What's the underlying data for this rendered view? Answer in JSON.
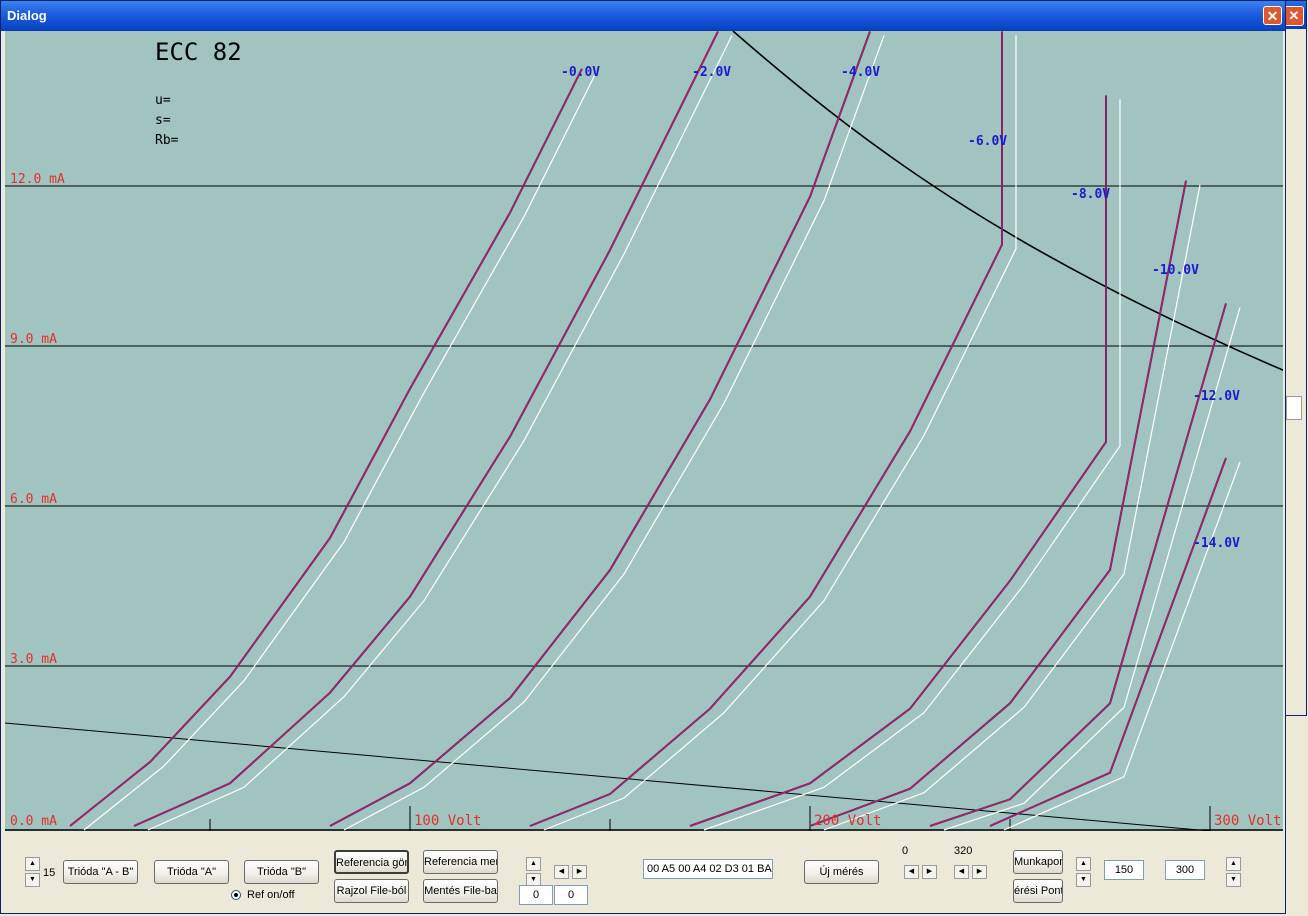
{
  "window": {
    "title": "Dialog",
    "close_glyph": "✕"
  },
  "plot": {
    "tube": "ECC 82",
    "params": {
      "u": "u=",
      "s": "s=",
      "rb": "Rb="
    },
    "y_labels": [
      "12.0 mA",
      "9.0 mA",
      "6.0 mA",
      "3.0 mA",
      "0.0 mA"
    ],
    "x_labels": [
      "100 Volt",
      "200 Volt",
      "300 Volt"
    ],
    "grid_labels": [
      "-0.0V",
      "-2.0V",
      "-4.0V",
      "-6.0V",
      "-8.0V",
      "-10.0V",
      "-12.0V",
      "-14.0V"
    ],
    "colors": {
      "background": "#a1c4c0",
      "axis_text": "#e03030",
      "grid_text": "#1a1ad0",
      "measured": "#2020d0",
      "reference": "#d02020",
      "alt": "#ffffff"
    }
  },
  "chart_data": {
    "type": "line",
    "xlabel": "Volt",
    "ylabel": "mA",
    "xlim": [
      0,
      320
    ],
    "ylim": [
      0,
      15
    ],
    "x_ticks": [
      "100 Volt",
      "200 Volt",
      "300 Volt"
    ],
    "y_ticks": [
      "0.0 mA",
      "3.0 mA",
      "6.0 mA",
      "9.0 mA",
      "12.0 mA"
    ],
    "series": [
      {
        "name": "-0.0V",
        "points": [
          [
            15,
            0
          ],
          [
            35,
            1.2
          ],
          [
            55,
            2.8
          ],
          [
            80,
            5.4
          ],
          [
            100,
            8.2
          ],
          [
            125,
            11.5
          ],
          [
            143,
            14.2
          ]
        ]
      },
      {
        "name": "-2.0V",
        "points": [
          [
            31,
            0
          ],
          [
            55,
            0.8
          ],
          [
            80,
            2.5
          ],
          [
            100,
            4.3
          ],
          [
            125,
            7.3
          ],
          [
            150,
            10.8
          ],
          [
            177,
            14.9
          ]
        ]
      },
      {
        "name": "-4.0V",
        "points": [
          [
            80,
            0
          ],
          [
            100,
            0.8
          ],
          [
            125,
            2.4
          ],
          [
            150,
            4.8
          ],
          [
            175,
            8.0
          ],
          [
            200,
            11.8
          ],
          [
            215,
            14.9
          ]
        ]
      },
      {
        "name": "-6.0V",
        "points": [
          [
            130,
            0
          ],
          [
            150,
            0.6
          ],
          [
            175,
            2.2
          ],
          [
            200,
            4.3
          ],
          [
            225,
            7.4
          ],
          [
            248,
            10.9
          ],
          [
            248,
            14.9
          ]
        ]
      },
      {
        "name": "-8.0V",
        "points": [
          [
            170,
            0
          ],
          [
            200,
            0.8
          ],
          [
            225,
            2.2
          ],
          [
            250,
            4.6
          ],
          [
            274,
            7.2
          ],
          [
            274,
            13.7
          ]
        ]
      },
      {
        "name": "-10.0V",
        "points": [
          [
            200,
            0
          ],
          [
            225,
            0.7
          ],
          [
            250,
            2.3
          ],
          [
            275,
            4.8
          ],
          [
            294,
            12.1
          ]
        ]
      },
      {
        "name": "-12.0V",
        "points": [
          [
            230,
            0
          ],
          [
            250,
            0.5
          ],
          [
            275,
            2.3
          ],
          [
            304,
            9.8
          ]
        ]
      },
      {
        "name": "-14.0V",
        "points": [
          [
            245,
            0
          ],
          [
            275,
            1.0
          ],
          [
            304,
            6.9
          ]
        ]
      }
    ]
  },
  "controls": {
    "spin_value": "15",
    "buttons": {
      "trioda_ab": "Trióda \"A - B\"",
      "trioda_a": "Trióda  \"A\"",
      "trioda_b": "Trióda  \"B\"",
      "ref_curve": "Referencia görb",
      "ref_save": "Referencia menté",
      "draw_file": "Rajzol File-ból",
      "save_file": "Mentés File-ba",
      "new_measure": "Új mérés",
      "workpoint": "Munkapon",
      "meas_point": "érési Pont"
    },
    "ref_onoff": "Ref on/off",
    "field_a": "0",
    "field_b": "0",
    "hex_value": "00 A5 00 A4 02 D3 01 BA",
    "range_min": "0",
    "range_max": "320",
    "value_1": "150",
    "value_2": "300",
    "arrow_up": "▲",
    "arrow_down": "▼",
    "arrow_left": "◀",
    "arrow_right": "▶"
  }
}
